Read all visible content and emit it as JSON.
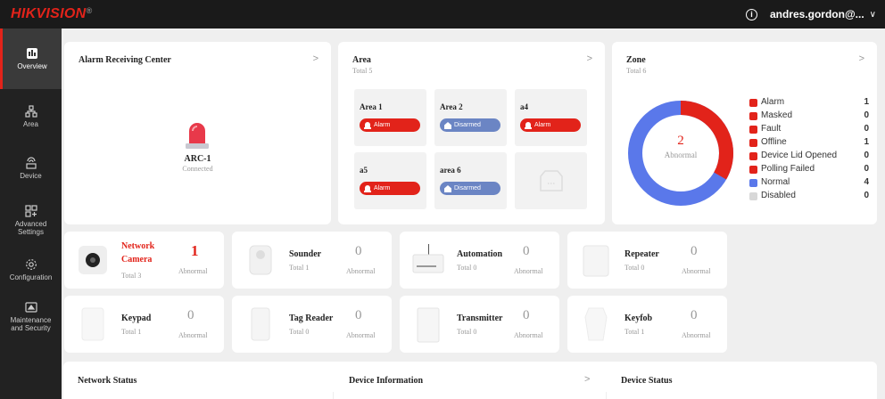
{
  "header": {
    "logo": "HIKVISION",
    "logo_mark": "®",
    "user": "andres.gordon@...",
    "chevron": "∨"
  },
  "sidebar": {
    "items": [
      {
        "label": "Overview",
        "icon": "overview-icon"
      },
      {
        "label": "Area",
        "icon": "area-icon"
      },
      {
        "label": "Device",
        "icon": "device-icon"
      },
      {
        "label": "Advanced Settings",
        "icon": "advanced-settings-icon"
      },
      {
        "label": "Configuration",
        "icon": "configuration-icon"
      },
      {
        "label": "Maintenance and Security",
        "icon": "maintenance-icon"
      }
    ]
  },
  "arc": {
    "title": "Alarm Receiving Center",
    "arrow": ">",
    "name": "ARC-1",
    "status": "Connected"
  },
  "area": {
    "title": "Area",
    "total": "Total 5",
    "arrow": ">",
    "tiles": [
      {
        "name": "Area 1",
        "status": "Alarm"
      },
      {
        "name": "Area 2",
        "status": "Disarmed"
      },
      {
        "name": "a4",
        "status": "Alarm"
      },
      {
        "name": "a5",
        "status": "Alarm"
      },
      {
        "name": "area 6",
        "status": "Disarmed"
      }
    ]
  },
  "zone": {
    "title": "Zone",
    "total": "Total 6",
    "arrow": ">",
    "center_value": "2",
    "center_label": "Abnormal",
    "abnormal_fraction": 0.333,
    "legend": [
      {
        "label": "Alarm",
        "value": "1",
        "color": "#e2231a"
      },
      {
        "label": "Masked",
        "value": "0",
        "color": "#e2231a"
      },
      {
        "label": "Fault",
        "value": "0",
        "color": "#e2231a"
      },
      {
        "label": "Offline",
        "value": "1",
        "color": "#e2231a"
      },
      {
        "label": "Device Lid Opened",
        "value": "0",
        "color": "#e2231a"
      },
      {
        "label": "Polling Failed",
        "value": "0",
        "color": "#e2231a"
      },
      {
        "label": "Normal",
        "value": "4",
        "color": "#5a78ea"
      },
      {
        "label": "Disabled",
        "value": "0",
        "color": "#d8d8d8"
      }
    ]
  },
  "devices": [
    {
      "name": "Network Camera",
      "total": "Total 3",
      "abnormal": "1",
      "abnormal_label": "Abnormal"
    },
    {
      "name": "Sounder",
      "total": "Total 1",
      "abnormal": "0",
      "abnormal_label": "Abnormal"
    },
    {
      "name": "Automation",
      "total": "Total 0",
      "abnormal": "0",
      "abnormal_label": "Abnormal"
    },
    {
      "name": "Repeater",
      "total": "Total 0",
      "abnormal": "0",
      "abnormal_label": "Abnormal"
    },
    {
      "name": "Keypad",
      "total": "Total 1",
      "abnormal": "0",
      "abnormal_label": "Abnormal"
    },
    {
      "name": "Tag Reader",
      "total": "Total 0",
      "abnormal": "0",
      "abnormal_label": "Abnormal"
    },
    {
      "name": "Transmitter",
      "total": "Total 0",
      "abnormal": "0",
      "abnormal_label": "Abnormal"
    },
    {
      "name": "Keyfob",
      "total": "Total 1",
      "abnormal": "0",
      "abnormal_label": "Abnormal"
    }
  ],
  "bottom": {
    "network_status": "Network Status",
    "device_information": "Device Information",
    "device_status": "Device Status",
    "arrow": ">"
  },
  "colors": {
    "accent": "#e2231a",
    "disarmed": "#6b85c4",
    "normal": "#5a78ea"
  }
}
